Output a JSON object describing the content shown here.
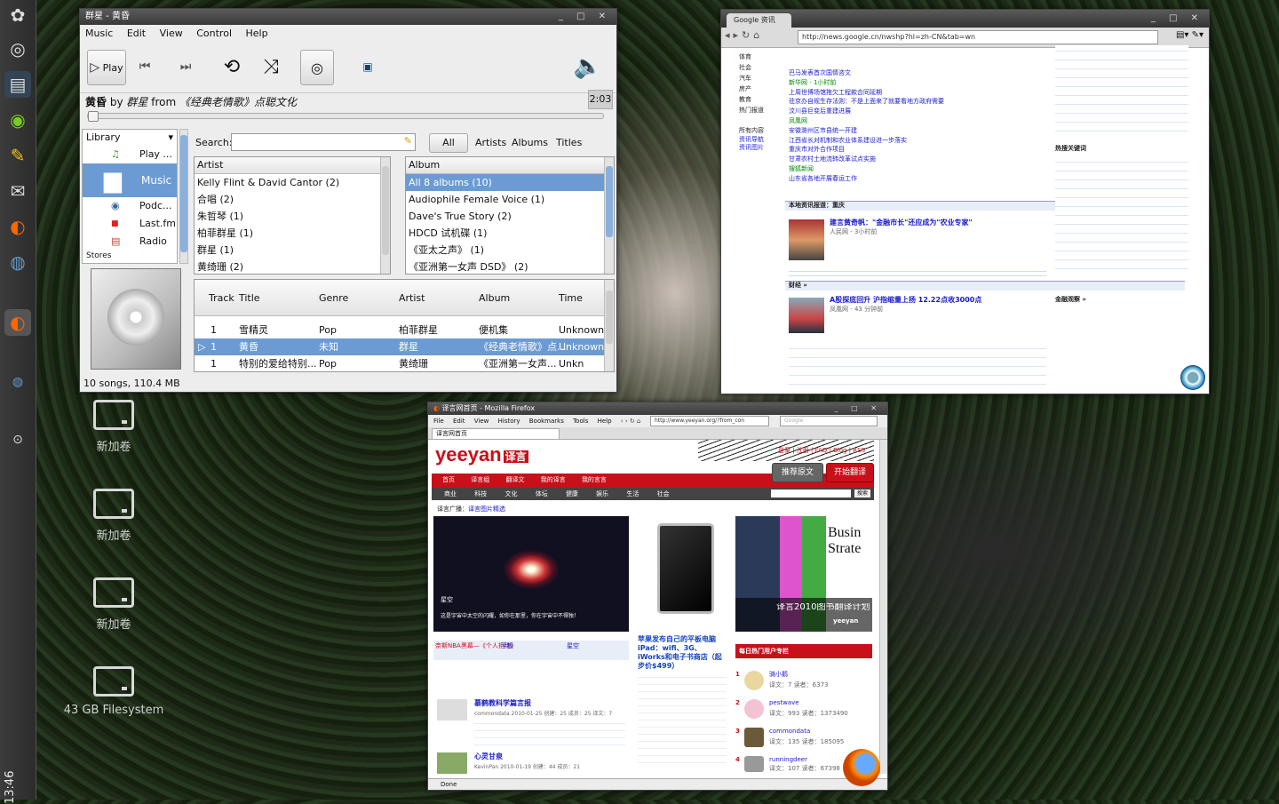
{
  "panel": {
    "icons": [
      "gnome-foot-icon",
      "disc-icon",
      "terminal-icon",
      "nvidia-icon",
      "edit-icon",
      "mail-icon",
      "firefox-icon",
      "chrome-icon",
      "firefox-small-icon",
      "web-icon",
      "disc-small-icon"
    ],
    "clock": "13:46"
  },
  "desktop": {
    "icons": [
      {
        "label": "新加卷"
      },
      {
        "label": "新加卷"
      },
      {
        "label": "新加卷"
      },
      {
        "label": "43 GB Filesystem"
      }
    ]
  },
  "music": {
    "title": "群星 - 黄昏",
    "menu": [
      "Music",
      "Edit",
      "View",
      "Control",
      "Help"
    ],
    "play_label": "Play",
    "now_playing": {
      "title": "黄昏",
      "by": "by",
      "artist": "群星",
      "from": "from",
      "album": "《经典老情歌》点聪文化"
    },
    "time": "2:03",
    "progress": 0.0,
    "sidebar_header": "Library",
    "sidebar": [
      "Play ...",
      "Music",
      "Podc...",
      "Last.fm",
      "Radio",
      "Stores"
    ],
    "search_label": "Search:",
    "filters": [
      "All",
      "Artists",
      "Albums",
      "Titles"
    ],
    "artist_header": "Artist",
    "artists": [
      "Kelly Flint & David Cantor (2)",
      "合唱 (2)",
      "朱哲琴 (1)",
      "柏菲群星 (1)",
      "群星 (1)",
      "黄绮珊 (2)"
    ],
    "album_header": "Album",
    "albums": [
      "All 8 albums (10)",
      "Audiophile Female Voice (1)",
      "Dave's True Story (2)",
      "HDCD 试机碟 (1)",
      "《亚太之声》 (1)",
      "《亚洲第一女声 DSD》 (2)"
    ],
    "track_headers": [
      "Track",
      "Title",
      "Genre",
      "Artist",
      "Album",
      "Time"
    ],
    "tracks": [
      {
        "track": "1",
        "title": "雪精灵",
        "genre": "Pop",
        "artist": "柏菲群星",
        "album": "便机集",
        "time": "Unknown"
      },
      {
        "track": "1",
        "title": "黄昏",
        "genre": "未知",
        "artist": "群星",
        "album": "《经典老情歌》点...",
        "time": "Unknown"
      },
      {
        "track": "1",
        "title": "特别的爱给特别...",
        "genre": "Pop",
        "artist": "黄绮珊",
        "album": "《亚洲第一女声...",
        "time": "Unkn"
      }
    ],
    "status": "10 songs, 110.4 MB"
  },
  "chrome": {
    "tab": "Google 资讯",
    "url": "http://news.google.cn/nwshp?hl=zh-CN&tab=wn",
    "nav": [
      "体育",
      "社会",
      "汽车",
      "房产",
      "教育",
      "热门报道"
    ],
    "nav_sub": [
      "所有内容",
      "资讯导航",
      "资讯图片"
    ],
    "headlines": [
      "巴马发表首次国情咨文",
      "上周世博场馆拖欠工程款合同延期",
      "驻京办自规生存法则：不是上面来了就要看地方政府需要",
      "汶川县巨变后重建进展",
      "安徽滁州区市县统一开建",
      "江西省长对机制和农业体系建设进一步落实",
      "重庆市对外合作项目",
      "甘肃农村土地流转改革试点实施",
      "山东省各地开展春运工作"
    ],
    "section1": "本地资讯报道：重庆",
    "story1_title": "建言黄奇帆：\"金融市长\"还应成为\"农业专家\"",
    "story1_source": "人民网 - 3小时前",
    "section2": "财经 »",
    "story2_title": "A股探底回升 沪指缩量上扬 12.22点收3000点",
    "story2_source": "凤凰网 - 43 分钟前",
    "right_header": "热搜关键词",
    "right_header2": "金融观察 »"
  },
  "firefox": {
    "title": "译言网首页 - Mozilla Firefox",
    "menu": [
      "File",
      "Edit",
      "View",
      "History",
      "Bookmarks",
      "Tools",
      "Help"
    ],
    "url": "http://www.yeeyan.org/?from_con",
    "search_placeholder": "Google",
    "tab": "译言网首页",
    "logo": "yeeyan",
    "logo_cn": "译言",
    "top_links": "登录 | 注册 | FAQ | Blog | RSS",
    "nav": [
      "首页",
      "译言组",
      "翻译文",
      "我的译言",
      "我的言言"
    ],
    "subnav": [
      "商业",
      "科技",
      "文化",
      "体坛",
      "健康",
      "娱乐",
      "生活",
      "社会"
    ],
    "btn_recommend": "推荐原文",
    "btn_translate": "开始翻译",
    "search_btn": "搜索",
    "breadcrumb": "译言广播：",
    "breadcrumb_link": "译言图片精选",
    "hero_caption": "星空",
    "hero_sub": "这是宇宙中太空的闪耀，如你在那里，你在宇宙中不得独！",
    "ipad_headline": "苹果发布自己的平板电脑iPad：wifi、3G、iWorks和电子书商店（起步价$499）",
    "book_title": "译言2010图书翻译计划",
    "book_brand": "yeeyan",
    "hot_header": "每日热门用户专栏",
    "users": [
      {
        "rank": "1",
        "name": "骑小鹅",
        "stats": "译文：7 读者：6373"
      },
      {
        "rank": "2",
        "name": "pestwave",
        "stats": "译文：993 读者：1373490"
      },
      {
        "rank": "3",
        "name": "commondata",
        "stats": "译文：135 读者：185095"
      },
      {
        "rank": "4",
        "name": "runningdeer",
        "stats": "译文：107 读者：67398"
      }
    ],
    "list_items": [
      "奈斯NBA黑幕—《个人拒绝》",
      "平板",
      "星空"
    ],
    "item_title": "慕鹤教科学篇言报",
    "item_meta": "commondata  2010-01-25  创建：25  成员：25  译文：7",
    "item2_title": "心灵甘泉",
    "item2_meta": "KevinPan  2010-01-19  创建：44  成员：21",
    "status": "Done"
  }
}
